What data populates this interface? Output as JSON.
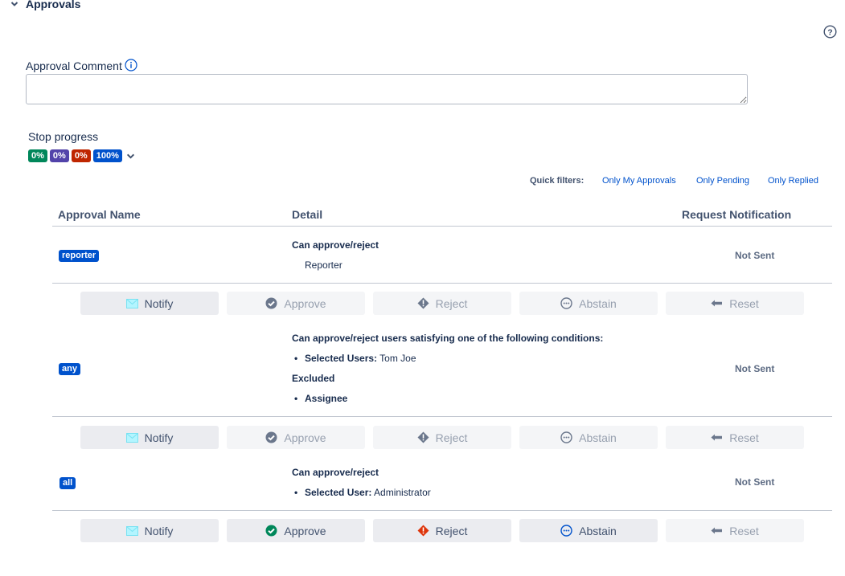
{
  "section": {
    "title": "Approvals"
  },
  "comment": {
    "label": "Approval Comment",
    "value": ""
  },
  "progress": {
    "label": "Stop progress",
    "badges": [
      {
        "text": "0%",
        "color": "#00875a"
      },
      {
        "text": "0%",
        "color": "#5243aa"
      },
      {
        "text": "0%",
        "color": "#bf2600"
      },
      {
        "text": "100%",
        "color": "#0052cc"
      }
    ]
  },
  "quick_filters": {
    "label": "Quick filters:",
    "items": [
      "Only My Approvals",
      "Only Pending",
      "Only Replied"
    ]
  },
  "table": {
    "headers": [
      "Approval Name",
      "Detail",
      "Request Notification"
    ],
    "rows": [
      {
        "name": "reporter",
        "detail_title": "Can approve/reject",
        "detail_value": "Reporter",
        "status": "Not Sent"
      },
      {
        "name": "any",
        "detail_title": "Can approve/reject users satisfying one of the following conditions:",
        "selected_label": "Selected Users:",
        "selected_value": "Tom Joe",
        "excluded_label": "Excluded",
        "excluded_item": "Assignee",
        "status": "Not Sent"
      },
      {
        "name": "all",
        "detail_title": "Can approve/reject",
        "selected_label": "Selected User:",
        "selected_value": "Administrator",
        "status": "Not Sent"
      }
    ]
  },
  "actions": {
    "notify": "Notify",
    "approve": "Approve",
    "reject": "Reject",
    "abstain": "Abstain",
    "reset": "Reset"
  },
  "colors": {
    "approve_active": "#00875a",
    "reject_active": "#de350b",
    "abstain_active": "#0052cc",
    "notify_icon": "#79e2f2"
  }
}
